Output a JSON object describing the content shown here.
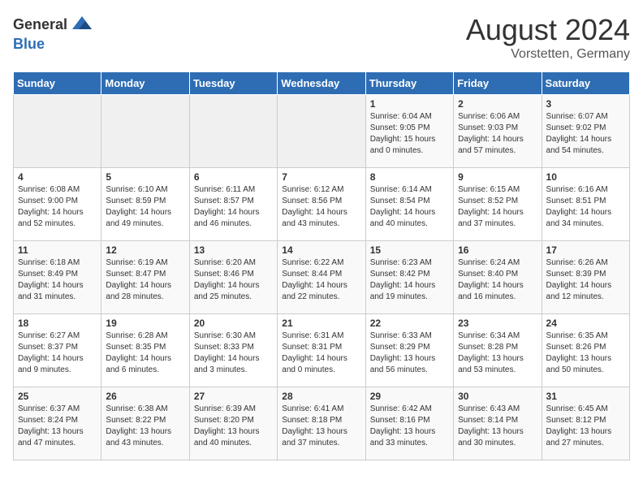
{
  "header": {
    "logo_general": "General",
    "logo_blue": "Blue",
    "month_year": "August 2024",
    "location": "Vorstetten, Germany"
  },
  "weekdays": [
    "Sunday",
    "Monday",
    "Tuesday",
    "Wednesday",
    "Thursday",
    "Friday",
    "Saturday"
  ],
  "weeks": [
    [
      {
        "day": "",
        "info": ""
      },
      {
        "day": "",
        "info": ""
      },
      {
        "day": "",
        "info": ""
      },
      {
        "day": "",
        "info": ""
      },
      {
        "day": "1",
        "info": "Sunrise: 6:04 AM\nSunset: 9:05 PM\nDaylight: 15 hours\nand 0 minutes."
      },
      {
        "day": "2",
        "info": "Sunrise: 6:06 AM\nSunset: 9:03 PM\nDaylight: 14 hours\nand 57 minutes."
      },
      {
        "day": "3",
        "info": "Sunrise: 6:07 AM\nSunset: 9:02 PM\nDaylight: 14 hours\nand 54 minutes."
      }
    ],
    [
      {
        "day": "4",
        "info": "Sunrise: 6:08 AM\nSunset: 9:00 PM\nDaylight: 14 hours\nand 52 minutes."
      },
      {
        "day": "5",
        "info": "Sunrise: 6:10 AM\nSunset: 8:59 PM\nDaylight: 14 hours\nand 49 minutes."
      },
      {
        "day": "6",
        "info": "Sunrise: 6:11 AM\nSunset: 8:57 PM\nDaylight: 14 hours\nand 46 minutes."
      },
      {
        "day": "7",
        "info": "Sunrise: 6:12 AM\nSunset: 8:56 PM\nDaylight: 14 hours\nand 43 minutes."
      },
      {
        "day": "8",
        "info": "Sunrise: 6:14 AM\nSunset: 8:54 PM\nDaylight: 14 hours\nand 40 minutes."
      },
      {
        "day": "9",
        "info": "Sunrise: 6:15 AM\nSunset: 8:52 PM\nDaylight: 14 hours\nand 37 minutes."
      },
      {
        "day": "10",
        "info": "Sunrise: 6:16 AM\nSunset: 8:51 PM\nDaylight: 14 hours\nand 34 minutes."
      }
    ],
    [
      {
        "day": "11",
        "info": "Sunrise: 6:18 AM\nSunset: 8:49 PM\nDaylight: 14 hours\nand 31 minutes."
      },
      {
        "day": "12",
        "info": "Sunrise: 6:19 AM\nSunset: 8:47 PM\nDaylight: 14 hours\nand 28 minutes."
      },
      {
        "day": "13",
        "info": "Sunrise: 6:20 AM\nSunset: 8:46 PM\nDaylight: 14 hours\nand 25 minutes."
      },
      {
        "day": "14",
        "info": "Sunrise: 6:22 AM\nSunset: 8:44 PM\nDaylight: 14 hours\nand 22 minutes."
      },
      {
        "day": "15",
        "info": "Sunrise: 6:23 AM\nSunset: 8:42 PM\nDaylight: 14 hours\nand 19 minutes."
      },
      {
        "day": "16",
        "info": "Sunrise: 6:24 AM\nSunset: 8:40 PM\nDaylight: 14 hours\nand 16 minutes."
      },
      {
        "day": "17",
        "info": "Sunrise: 6:26 AM\nSunset: 8:39 PM\nDaylight: 14 hours\nand 12 minutes."
      }
    ],
    [
      {
        "day": "18",
        "info": "Sunrise: 6:27 AM\nSunset: 8:37 PM\nDaylight: 14 hours\nand 9 minutes."
      },
      {
        "day": "19",
        "info": "Sunrise: 6:28 AM\nSunset: 8:35 PM\nDaylight: 14 hours\nand 6 minutes."
      },
      {
        "day": "20",
        "info": "Sunrise: 6:30 AM\nSunset: 8:33 PM\nDaylight: 14 hours\nand 3 minutes."
      },
      {
        "day": "21",
        "info": "Sunrise: 6:31 AM\nSunset: 8:31 PM\nDaylight: 14 hours\nand 0 minutes."
      },
      {
        "day": "22",
        "info": "Sunrise: 6:33 AM\nSunset: 8:29 PM\nDaylight: 13 hours\nand 56 minutes."
      },
      {
        "day": "23",
        "info": "Sunrise: 6:34 AM\nSunset: 8:28 PM\nDaylight: 13 hours\nand 53 minutes."
      },
      {
        "day": "24",
        "info": "Sunrise: 6:35 AM\nSunset: 8:26 PM\nDaylight: 13 hours\nand 50 minutes."
      }
    ],
    [
      {
        "day": "25",
        "info": "Sunrise: 6:37 AM\nSunset: 8:24 PM\nDaylight: 13 hours\nand 47 minutes."
      },
      {
        "day": "26",
        "info": "Sunrise: 6:38 AM\nSunset: 8:22 PM\nDaylight: 13 hours\nand 43 minutes."
      },
      {
        "day": "27",
        "info": "Sunrise: 6:39 AM\nSunset: 8:20 PM\nDaylight: 13 hours\nand 40 minutes."
      },
      {
        "day": "28",
        "info": "Sunrise: 6:41 AM\nSunset: 8:18 PM\nDaylight: 13 hours\nand 37 minutes."
      },
      {
        "day": "29",
        "info": "Sunrise: 6:42 AM\nSunset: 8:16 PM\nDaylight: 13 hours\nand 33 minutes."
      },
      {
        "day": "30",
        "info": "Sunrise: 6:43 AM\nSunset: 8:14 PM\nDaylight: 13 hours\nand 30 minutes."
      },
      {
        "day": "31",
        "info": "Sunrise: 6:45 AM\nSunset: 8:12 PM\nDaylight: 13 hours\nand 27 minutes."
      }
    ]
  ]
}
